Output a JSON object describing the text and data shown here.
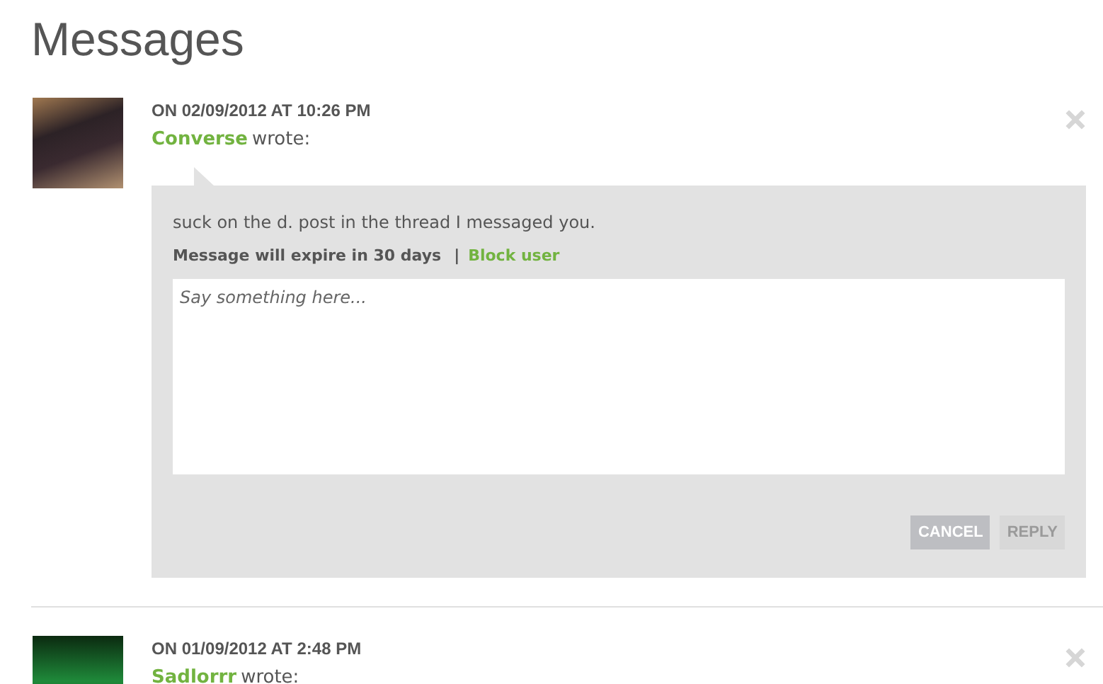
{
  "title": "Messages",
  "messages": [
    {
      "date": "ON 02/09/2012 AT 10:26 PM",
      "author": "Converse",
      "verb": "wrote:",
      "body": "suck on the d. post in the thread I messaged you.",
      "expiry": "Message will expire in 30 days",
      "separator": "|",
      "block_link": "Block user",
      "reply": {
        "placeholder": "Say something here...",
        "buttons": [
          {
            "label": "CANCEL",
            "disabled": false
          },
          {
            "label": "REPLY",
            "disabled": true
          }
        ]
      }
    },
    {
      "date": "ON 01/09/2012 AT 2:48 PM",
      "author": "Sadlorrr",
      "verb": "wrote:"
    }
  ]
}
